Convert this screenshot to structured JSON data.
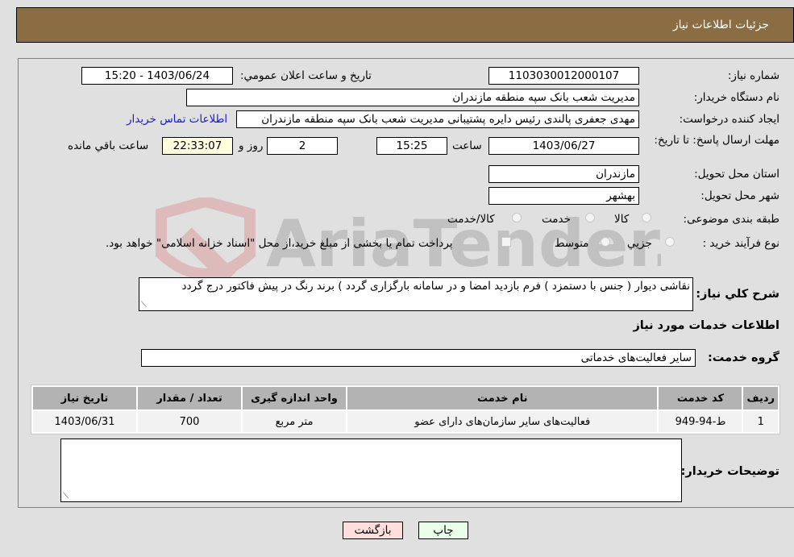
{
  "header": {
    "title": "جزئیات اطلاعات نیاز"
  },
  "fields": {
    "need_number_label": "شماره نیاز:",
    "need_number": "1103030012000107",
    "announce_label": "تاریخ و ساعت اعلان عمومي:",
    "announce_value": "1403/06/24 - 15:20",
    "buyer_org_label": "نام دستگاه خريدار:",
    "buyer_org": "مدیریت شعب بانک سپه منطقه مازندران",
    "creator_label": "ایجاد کننده درخواست:",
    "creator": "مهدی جعفری پالندی رئیس دایره پشتیبانی مدیریت شعب بانک سپه منطقه مازندران",
    "contact_link": "اطلاعات تماس خريدار",
    "deadline_label": "مهلت ارسال پاسخ: تا تاریخ:",
    "deadline_date": "1403/06/27",
    "time_label": "ساعت",
    "deadline_time": "15:25",
    "days_value": "2",
    "days_label": "روز و",
    "remaining_time": "22:33:07",
    "remaining_label": "ساعت باقي مانده",
    "province_label": "استان محل تحویل:",
    "province": "مازندران",
    "city_label": "شهر محل تحویل:",
    "city": "بهشهر",
    "category_label": "طبقه بندی موضوعی:",
    "category_options": [
      "کالا",
      "خدمت",
      "کالا/خدمت"
    ],
    "purchase_type_label": "نوع فرآیند خرید :",
    "purchase_type_options": [
      "جزيي",
      "متوسط"
    ],
    "treasury_note": "پرداخت تمام یا بخشی از مبلغ خرید،از محل \"اسناد خزانه اسلامی\" خواهد بود."
  },
  "description": {
    "label": "شرح کلي نياز:",
    "value": "نقاشی دیوار ( جنس با دستمزد ) فرم بازدید امضا و در سامانه بارگزاری گردد ) برند رنگ در پیش فاکتور درج گردد"
  },
  "services": {
    "section_title": "اطلاعات خدمات مورد نیاز",
    "group_label": "گروه خدمت:",
    "group_value": "سایر فعالیت‌های خدماتی",
    "table": {
      "headers": [
        "ردیف",
        "کد خدمت",
        "نام خدمت",
        "واحد اندازه گیری",
        "تعداد / مقدار",
        "تاریخ نیاز"
      ],
      "rows": [
        [
          "1",
          "ط-94-949",
          "فعالیت‌های سایر سازمان‌های دارای عضو",
          "متر مربع",
          "700",
          "1403/06/31"
        ]
      ]
    }
  },
  "buyer_notes": {
    "label": "توضیحات خریدار:",
    "value": ""
  },
  "buttons": {
    "print": "چاپ",
    "back": "بازگشت"
  },
  "watermark": {
    "text": "AriaTender.neT"
  }
}
